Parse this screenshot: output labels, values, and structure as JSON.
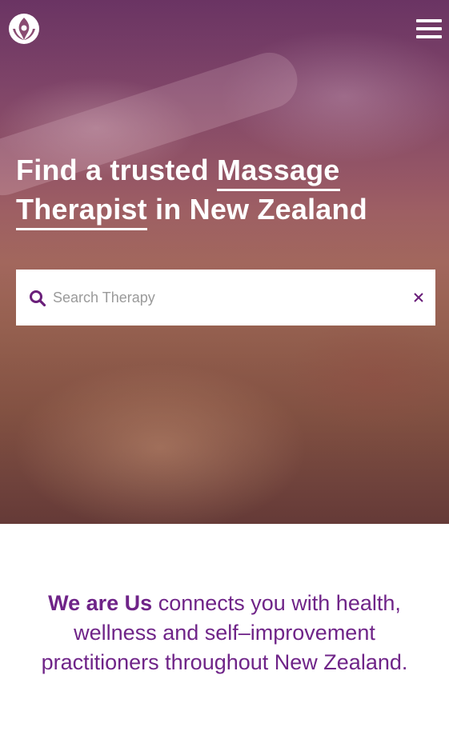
{
  "header": {
    "logo_icon": "flame-person-logo",
    "menu_icon": "hamburger-menu-icon"
  },
  "hero": {
    "title_part1": "Find a trusted ",
    "title_highlight1": "Massage ",
    "title_highlight2": "Therapist",
    "title_part2": " in New Zealand"
  },
  "search": {
    "placeholder": "Search Therapy",
    "value": "",
    "search_icon": "search-icon",
    "clear_icon": "close-icon"
  },
  "intro": {
    "brand": "We are Us",
    "text": " connects you with health, wellness and self–improvement practitioners throughout New Zealand."
  },
  "colors": {
    "accent": "#6f2488",
    "search_icon": "#6a1f7a",
    "text_on_hero": "#ffffff"
  }
}
